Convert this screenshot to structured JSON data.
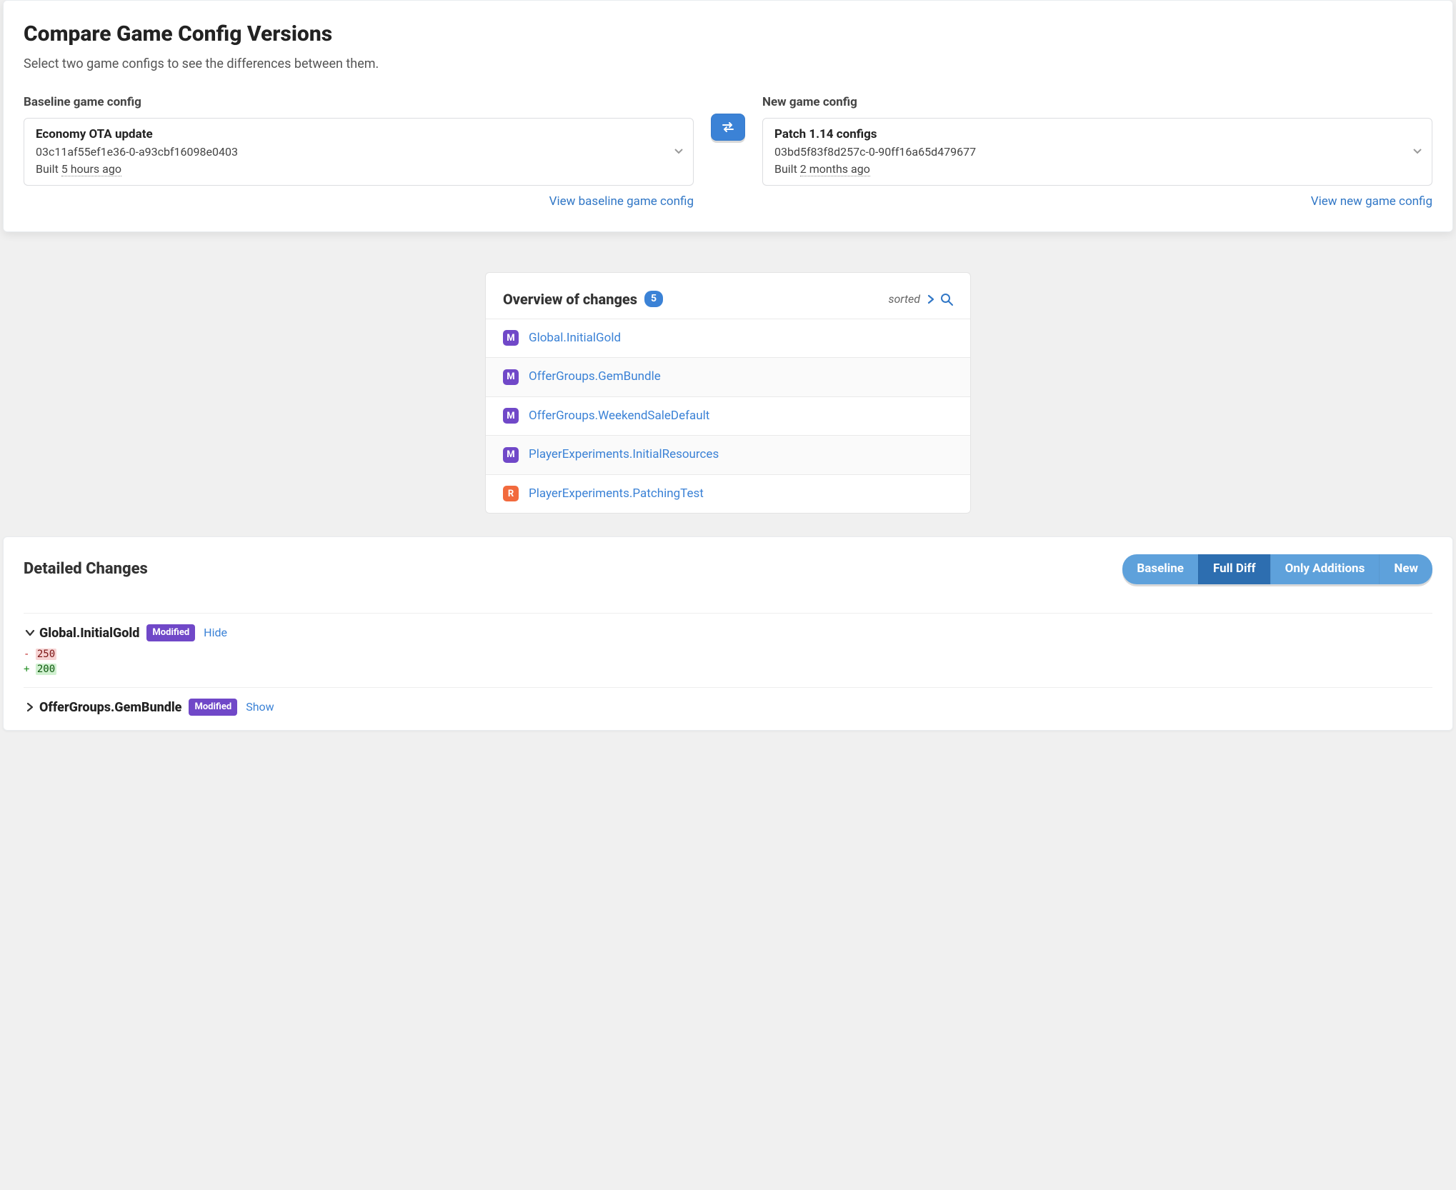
{
  "header": {
    "title": "Compare Game Config Versions",
    "subtitle": "Select two game configs to see the differences between them."
  },
  "baseline": {
    "label": "Baseline game config",
    "name": "Economy OTA update",
    "hash": "03c11af55ef1e36-0-a93cbf16098e0403",
    "built_prefix": "Built ",
    "built_ago": "5 hours ago",
    "view_link": "View baseline game config"
  },
  "new": {
    "label": "New game config",
    "name": "Patch 1.14 configs",
    "hash": "03bd5f83f8d257c-0-90ff16a65d479677",
    "built_prefix": "Built ",
    "built_ago": "2 months ago",
    "view_link": "View new game config"
  },
  "overview": {
    "title": "Overview of changes",
    "count": "5",
    "sorted_label": "sorted",
    "items": [
      {
        "badge": "M",
        "name": "Global.InitialGold"
      },
      {
        "badge": "M",
        "name": "OfferGroups.GemBundle"
      },
      {
        "badge": "M",
        "name": "OfferGroups.WeekendSaleDefault"
      },
      {
        "badge": "M",
        "name": "PlayerExperiments.InitialResources"
      },
      {
        "badge": "R",
        "name": "PlayerExperiments.PatchingTest"
      }
    ]
  },
  "detailed": {
    "title": "Detailed Changes",
    "segments": [
      "Baseline",
      "Full Diff",
      "Only Additions",
      "New"
    ],
    "active_segment": "Full Diff",
    "hide_label": "Hide",
    "show_label": "Show",
    "modified_label": "Modified",
    "blocks": [
      {
        "title": "Global.InitialGold",
        "status": "Modified",
        "expanded": true,
        "diff": {
          "removed": "250",
          "added": "200"
        }
      },
      {
        "title": "OfferGroups.GemBundle",
        "status": "Modified",
        "expanded": false
      }
    ]
  }
}
